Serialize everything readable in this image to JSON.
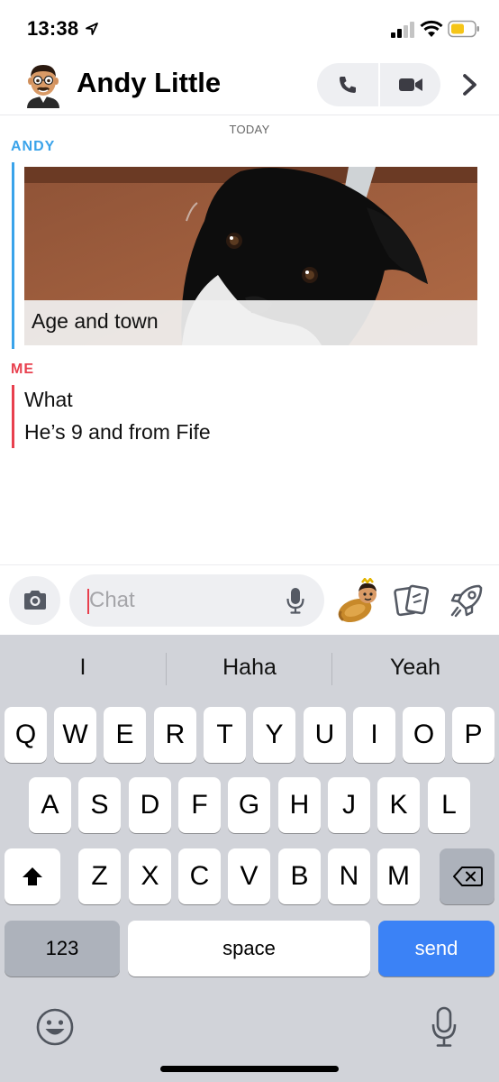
{
  "status_bar": {
    "time": "13:38",
    "icons": [
      "location-arrow-icon",
      "cellular-signal-icon",
      "wifi-icon",
      "battery-low-icon"
    ],
    "battery_color": "#f5c518"
  },
  "header": {
    "contact_name": "Andy Little",
    "icons": [
      "bitmoji-avatar",
      "phone-icon",
      "video-camera-icon",
      "chevron-right-icon"
    ]
  },
  "conversation": {
    "date_label": "TODAY",
    "messages": [
      {
        "sender": "ANDY",
        "sender_color": "#3aa3ea",
        "type": "snap",
        "caption": "Age and town"
      },
      {
        "sender": "ME",
        "sender_color": "#e8404e",
        "type": "text",
        "lines": [
          "What",
          "He’s 9 and from Fife"
        ]
      }
    ]
  },
  "input_bar": {
    "placeholder": "Chat",
    "value": "",
    "icons": [
      "camera-icon",
      "microphone-icon",
      "bitmoji-sticker-icon",
      "cards-icon",
      "rocket-icon"
    ]
  },
  "keyboard": {
    "suggestions": [
      "I",
      "Haha",
      "Yeah"
    ],
    "rows": [
      [
        "Q",
        "W",
        "E",
        "R",
        "T",
        "Y",
        "U",
        "I",
        "O",
        "P"
      ],
      [
        "A",
        "S",
        "D",
        "F",
        "G",
        "H",
        "J",
        "K",
        "L"
      ],
      [
        "Z",
        "X",
        "C",
        "V",
        "B",
        "N",
        "M"
      ]
    ],
    "numbers_label": "123",
    "space_label": "space",
    "send_label": "send",
    "send_color": "#3b82f6",
    "icons": [
      "shift-icon",
      "backspace-icon",
      "emoji-icon",
      "dictation-mic-icon"
    ]
  }
}
